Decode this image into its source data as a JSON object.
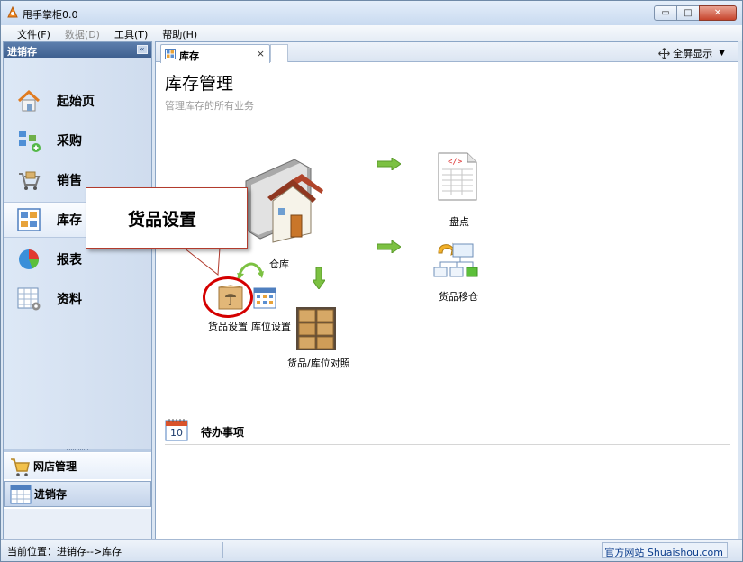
{
  "window": {
    "title": "甩手掌柜0.0",
    "minimize_glyph": "▭",
    "maximize_glyph": "□",
    "close_glyph": "✕"
  },
  "menubar": {
    "items": [
      {
        "label": "文件(F)",
        "disabled": false
      },
      {
        "label": "数据(D)",
        "disabled": true
      },
      {
        "label": "工具(T)",
        "disabled": false
      },
      {
        "label": "帮助(H)",
        "disabled": false
      }
    ]
  },
  "left_panel": {
    "header": "进销存",
    "collapse_glyph": "«",
    "nav_items": [
      {
        "label": "起始页",
        "icon": "home-icon"
      },
      {
        "label": "采购",
        "icon": "purchase-icon"
      },
      {
        "label": "销售",
        "icon": "sales-icon"
      },
      {
        "label": "库存",
        "icon": "inventory-icon",
        "active": true
      },
      {
        "label": "报表",
        "icon": "pie-chart-icon"
      },
      {
        "label": "资料",
        "icon": "data-icon"
      }
    ],
    "bottom_items": [
      {
        "label": "网店管理",
        "icon": "shopping-cart-icon"
      },
      {
        "label": "进销存",
        "icon": "calendar-grid-icon",
        "active": true
      }
    ]
  },
  "tabs": {
    "active_tab": "库存",
    "close_glyph": "×",
    "fullscreen_label": "全屏显示",
    "fullscreen_arrow": "▼"
  },
  "page": {
    "title": "库存管理",
    "subtitle": "管理库存的所有业务"
  },
  "diagram": {
    "warehouse": "仓库",
    "stocktake": "盘点",
    "goods_transfer": "货品移仓",
    "goods_settings": "货品设置",
    "location_settings": "库位设置",
    "goods_location_map": "货品/库位对照"
  },
  "todo": {
    "calendar_day": "10",
    "label": "待办事项"
  },
  "callout": {
    "text": "货品设置",
    "ring_color": "#d40000"
  },
  "statusbar": {
    "location": "当前位置：进销存-->库存",
    "website": "官方网站 Shuaishou.com"
  },
  "colors": {
    "accent": "#3e5f8f",
    "arrow_green": "#7cc142",
    "callout_border": "#b23b2d"
  }
}
